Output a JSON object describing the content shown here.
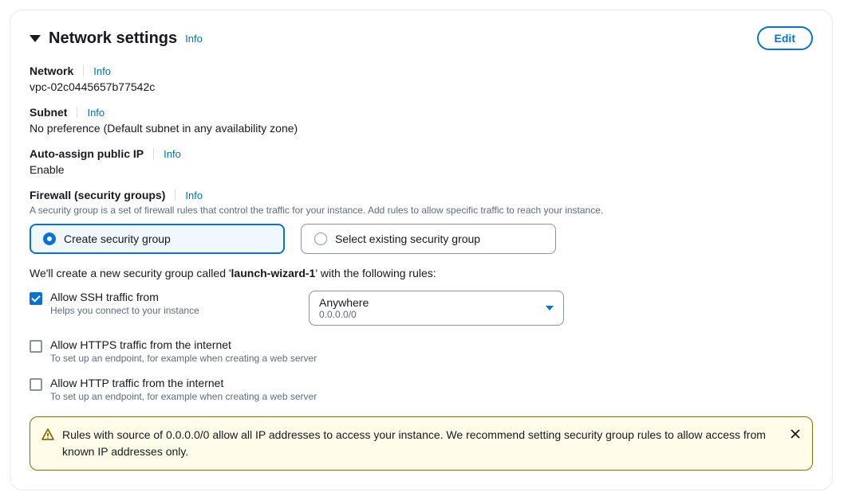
{
  "header": {
    "title": "Network settings",
    "info": "Info",
    "editLabel": "Edit"
  },
  "network": {
    "label": "Network",
    "info": "Info",
    "value": "vpc-02c0445657b77542c"
  },
  "subnet": {
    "label": "Subnet",
    "info": "Info",
    "value": "No preference (Default subnet in any availability zone)"
  },
  "autoIp": {
    "label": "Auto-assign public IP",
    "info": "Info",
    "value": "Enable"
  },
  "firewall": {
    "label": "Firewall (security groups)",
    "info": "Info",
    "desc": "A security group is a set of firewall rules that control the traffic for your instance. Add rules to allow specific traffic to reach your instance.",
    "options": {
      "create": "Create security group",
      "select": "Select existing security group"
    }
  },
  "sgLine": {
    "prefix": "We'll create a new security group called '",
    "name": "launch-wizard-1",
    "suffix": "' with the following rules:"
  },
  "rules": {
    "ssh": {
      "label": "Allow SSH traffic from",
      "desc": "Helps you connect to your instance",
      "select": {
        "main": "Anywhere",
        "sub": "0.0.0.0/0"
      }
    },
    "https": {
      "label": "Allow HTTPS traffic from the internet",
      "desc": "To set up an endpoint, for example when creating a web server"
    },
    "http": {
      "label": "Allow HTTP traffic from the internet",
      "desc": "To set up an endpoint, for example when creating a web server"
    }
  },
  "alert": {
    "text": "Rules with source of 0.0.0.0/0 allow all IP addresses to access your instance. We recommend setting security group rules to allow access from known IP addresses only."
  }
}
